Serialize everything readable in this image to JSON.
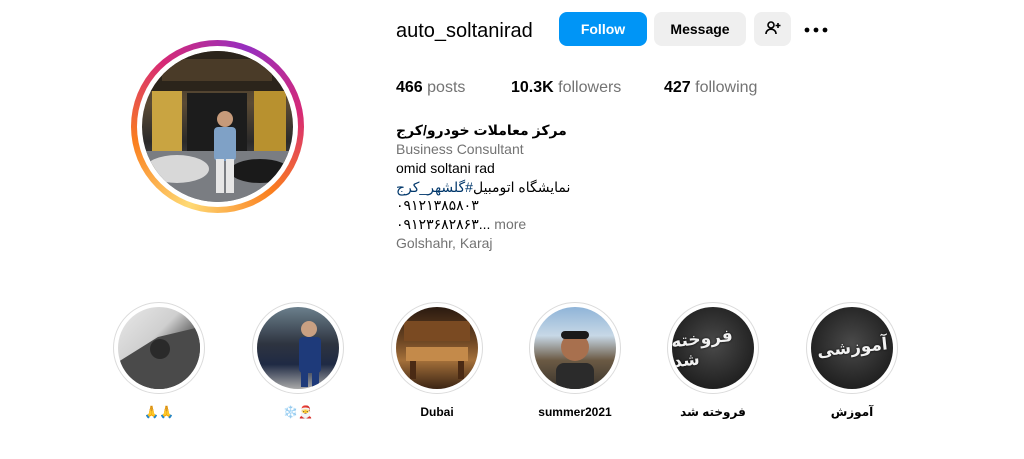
{
  "profile": {
    "username": "auto_soltanirad",
    "follow_label": "Follow",
    "message_label": "Message",
    "suggest_icon": "person-add-icon",
    "more_icon": "more-dots-icon"
  },
  "stats": {
    "posts_value": "466",
    "posts_label": "posts",
    "followers_value": "10.3K",
    "followers_label": "followers",
    "following_value": "427",
    "following_label": "following"
  },
  "bio": {
    "name": "مرکز معاملات خودرو/کرج",
    "category": "Business Consultant",
    "line1": "omid soltani rad",
    "line2_text": "نمایشگاه اتومبیل",
    "line2_tag": "#گلشهر_کرج",
    "line3": "۰۹۱۲۱۳۸۵۸۰۳",
    "line4": "۰۹۱۲۳۶۸۲۸۶۳...",
    "more": "more",
    "location": "Golshahr, Karaj"
  },
  "highlights": [
    {
      "label": "🙏🙏"
    },
    {
      "label": "❄️🎅"
    },
    {
      "label": "Dubai"
    },
    {
      "label": "summer2021"
    },
    {
      "label": "فروخته شد",
      "cover_text": "فروخته شد"
    },
    {
      "label": "آموزش",
      "cover_text": "آموزشی"
    }
  ],
  "colors": {
    "follow_button": "#0095f6",
    "secondary_button": "#efefef",
    "muted_text": "#737373",
    "hashtag": "#00376b"
  }
}
